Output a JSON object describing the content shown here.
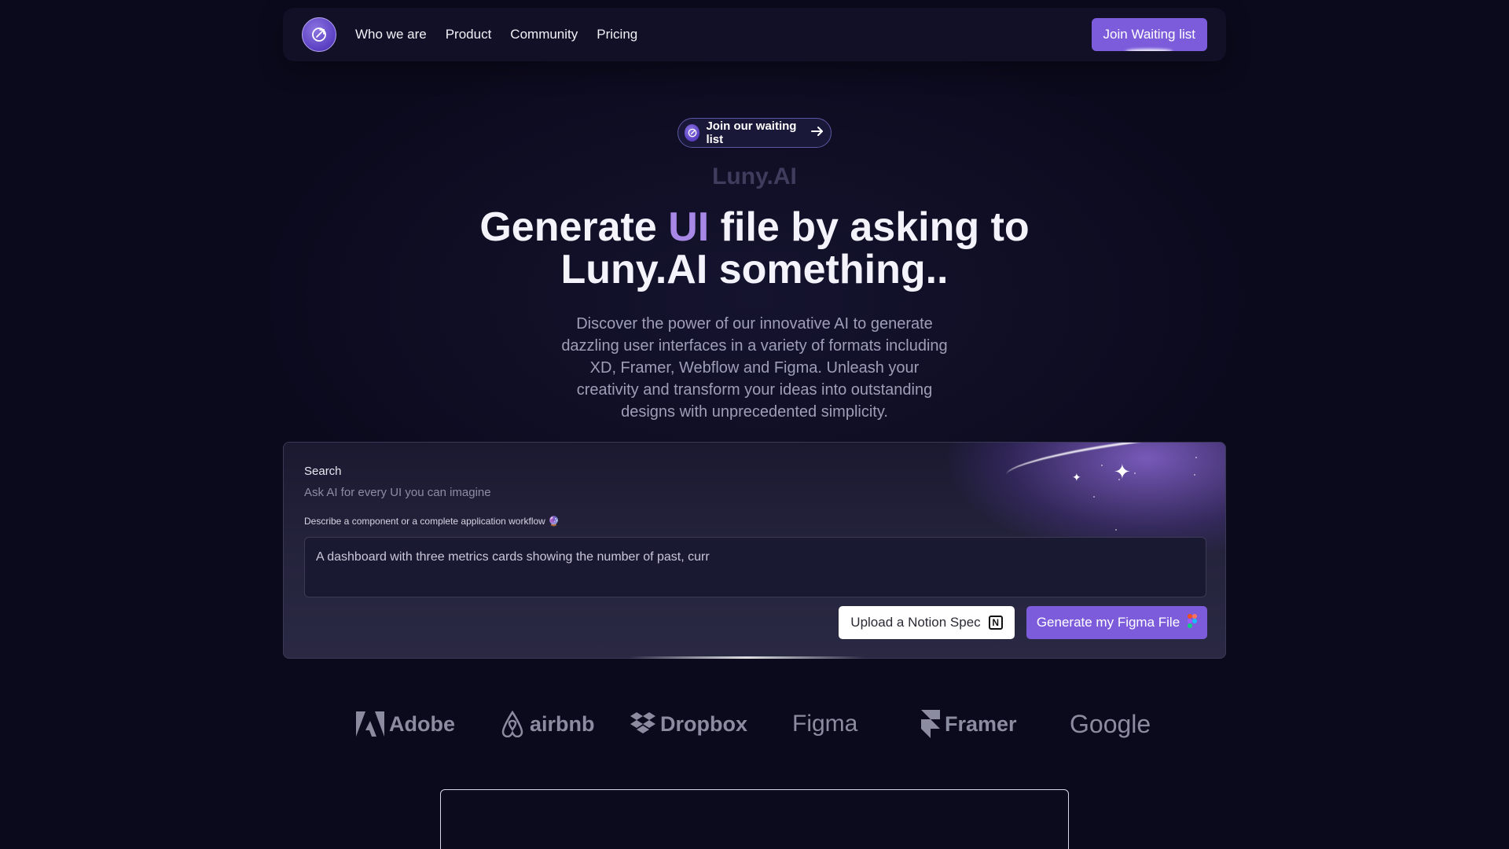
{
  "nav": {
    "links": [
      "Who we are",
      "Product",
      "Community",
      "Pricing"
    ],
    "cta": "Join Waiting list"
  },
  "hero": {
    "pill": "Join our waiting list",
    "brand": "Luny.AI",
    "headline_pre": "Generate ",
    "headline_accent": "UI",
    "headline_post": " file by asking to Luny.AI something..",
    "subtext": "Discover the power of our innovative AI to generate dazzling user interfaces in a variety of formats including XD, Framer, Webflow and Figma. Unleash your creativity and transform your ideas into outstanding designs with unprecedented simplicity."
  },
  "search": {
    "title": "Search",
    "subtitle": "Ask AI for every UI you can imagine",
    "hint": "Describe a component or a complete application workflow 🔮",
    "value": "A dashboard with three metrics cards showing the number of past, curr",
    "notion_button": "Upload a Notion Spec",
    "figma_button": "Generate my Figma File"
  },
  "logos": [
    "Adobe",
    "airbnb",
    "Dropbox",
    "Figma",
    "Framer",
    "Google"
  ],
  "colors": {
    "background": "#0b0a1d",
    "accent": "#7c5cdb",
    "headline_accent": "#a788e6"
  }
}
